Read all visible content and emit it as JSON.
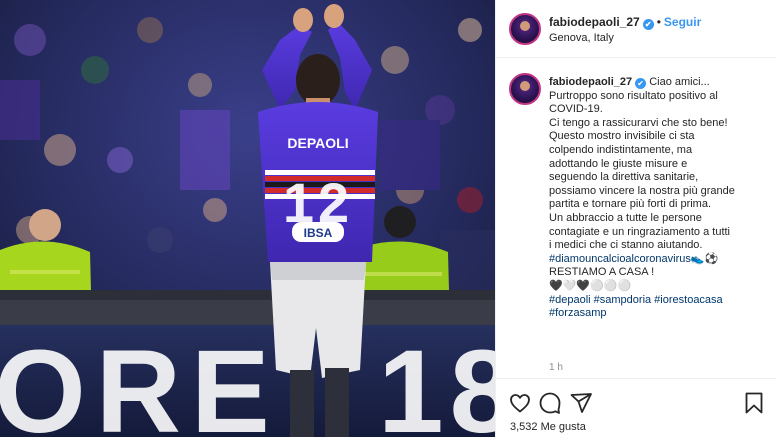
{
  "post": {
    "username": "fabiodepaoli_27",
    "verified_mark": "✔",
    "separator": "•",
    "follow_label": "Seguir",
    "location": "Genova, Italy"
  },
  "photo": {
    "jersey_name": "DEPAOLI",
    "jersey_number": "12",
    "sponsor": "IBSA",
    "board_text_left": "ORE",
    "board_text_right": "18",
    "colors": {
      "jersey": "#4b2fc9",
      "vest": "#9fd11f",
      "crowd": "#21295a"
    }
  },
  "caption": {
    "username": "fabiodepaoli_27",
    "lines": [
      "Ciao amici...",
      "Purtroppo sono risultato positivo al",
      "COVID-19.",
      "Ci tengo a rassicurarvi che sto bene!",
      "Questo mostro invisibile ci sta",
      "colpendo indistintamente, ma",
      "adottando le giuste misure e",
      "seguendo la direttiva sanitarie,",
      "possiamo vincere la nostra più grande",
      "partita e tornare più forti di prima.",
      "Un abbraccio a tutte le persone",
      "contagiate e un ringraziamento a tutti",
      "i medici che ci stanno aiutando."
    ],
    "hashtag_line": "#diamouncalcioalcoronavirus👟⚽",
    "shout": "RESTIAMO A CASA !",
    "emoji_line": "🖤🤍🖤⚪⚪⚪",
    "tags_line1": "#depaoli #sampdoria #iorestoacasa",
    "tags_line2": "#forzasamp",
    "time_ago": "1 h"
  },
  "actions": {
    "icons": [
      "heart-icon",
      "comment-icon",
      "share-icon",
      "bookmark-icon"
    ],
    "likes_text": "3,532 Me gusta"
  }
}
